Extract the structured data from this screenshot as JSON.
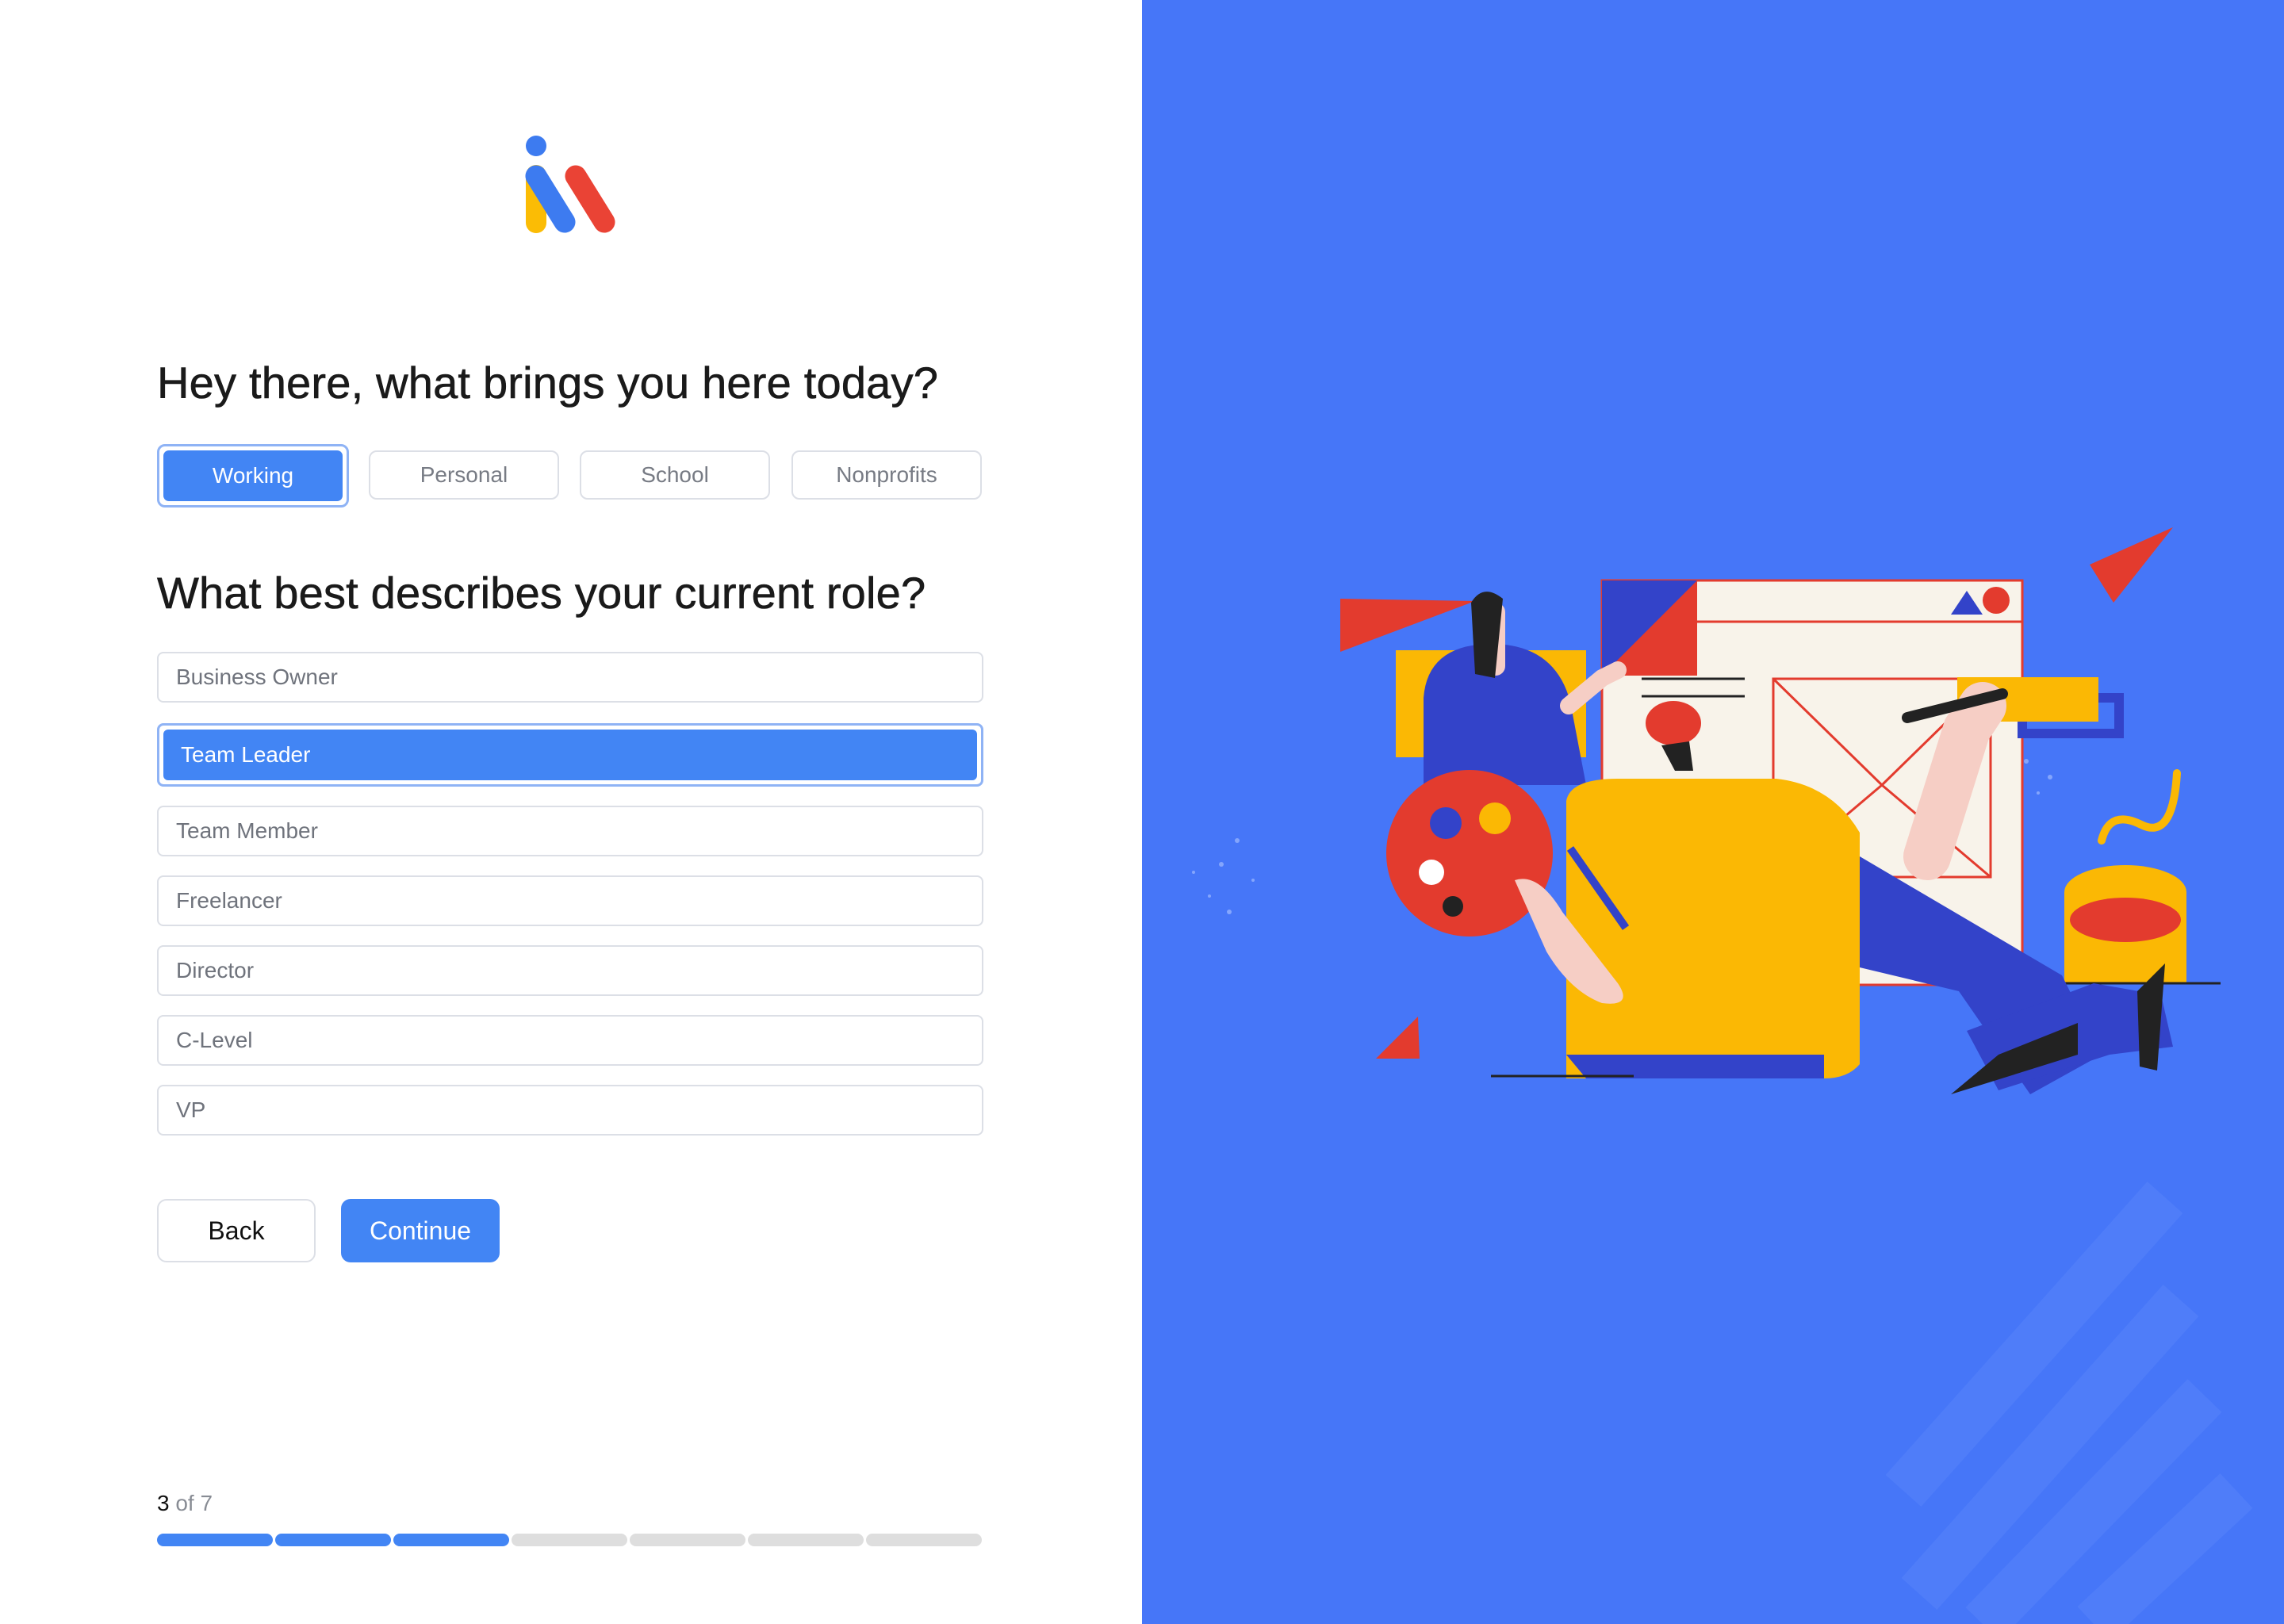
{
  "question1": "Hey there, what brings you here today?",
  "purposes": [
    {
      "label": "Working",
      "selected": true
    },
    {
      "label": "Personal",
      "selected": false
    },
    {
      "label": "School",
      "selected": false
    },
    {
      "label": "Nonprofits",
      "selected": false
    }
  ],
  "question2": "What best describes your current role?",
  "roles": [
    {
      "label": "Business Owner",
      "selected": false
    },
    {
      "label": "Team Leader",
      "selected": true
    },
    {
      "label": "Team Member",
      "selected": false
    },
    {
      "label": "Freelancer",
      "selected": false
    },
    {
      "label": "Director",
      "selected": false
    },
    {
      "label": "C-Level",
      "selected": false
    },
    {
      "label": "VP",
      "selected": false
    }
  ],
  "buttons": {
    "back": "Back",
    "continue": "Continue"
  },
  "progress": {
    "current": "3",
    "of_label": "of 7",
    "completed": 3,
    "total": 7
  },
  "colors": {
    "accent": "#4285f4",
    "panel": "#4676f8",
    "logo_blue": "#3d7bf0",
    "logo_yellow": "#fbbc05",
    "logo_red": "#ea4335"
  }
}
